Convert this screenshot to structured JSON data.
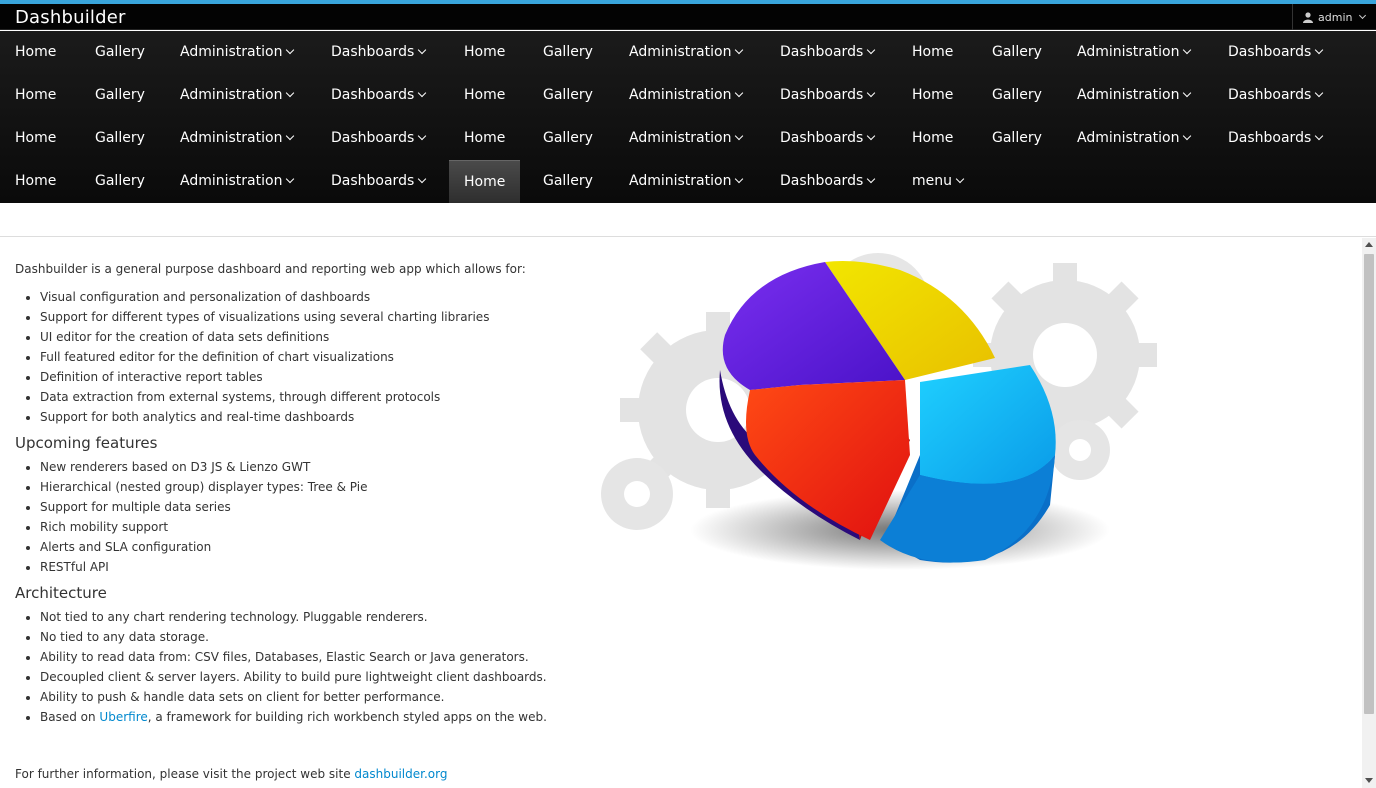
{
  "app": {
    "brand": "Dashbuilder",
    "user": "admin"
  },
  "nav": {
    "rows": [
      [
        "Home",
        "Gallery",
        "Administration",
        "Dashboards",
        "Home",
        "Gallery",
        "Administration",
        "Dashboards",
        "Home",
        "Gallery",
        "Administration",
        "Dashboards"
      ],
      [
        "Home",
        "Gallery",
        "Administration",
        "Dashboards",
        "Home",
        "Gallery",
        "Administration",
        "Dashboards",
        "Home",
        "Gallery",
        "Administration",
        "Dashboards"
      ],
      [
        "Home",
        "Gallery",
        "Administration",
        "Dashboards",
        "Home",
        "Gallery",
        "Administration",
        "Dashboards",
        "Home",
        "Gallery",
        "Administration",
        "Dashboards"
      ],
      [
        "Home",
        "Gallery",
        "Administration",
        "Dashboards",
        "Home",
        "Gallery",
        "Administration",
        "Dashboards",
        "menu"
      ]
    ],
    "active": "Home (row 4)"
  },
  "content": {
    "intro": "Dashbuilder is a general purpose dashboard and reporting web app which allows for:",
    "features": [
      "Visual configuration and personalization of dashboards",
      "Support for different types of visualizations using several charting libraries",
      "UI editor for the creation of data sets definitions",
      "Full featured editor for the definition of chart visualizations",
      "Definition of interactive report tables",
      "Data extraction from external systems, through different protocols",
      "Support for both analytics and real-time dashboards"
    ],
    "upcoming_title": "Upcoming features",
    "upcoming": [
      "New renderers based on D3 JS & Lienzo GWT",
      "Hierarchical (nested group) displayer types: Tree & Pie",
      "Support for multiple data series",
      "Rich mobility support",
      "Alerts and SLA configuration",
      "RESTful API"
    ],
    "architecture_title": "Architecture",
    "architecture": [
      "Not tied to any chart rendering technology. Pluggable renderers.",
      "No tied to any data storage.",
      "Ability to read data from: CSV files, Databases, Elastic Search or Java generators.",
      "Decoupled client & server layers. Ability to build pure lightweight client dashboards.",
      "Ability to push & handle data sets on client for better performance."
    ],
    "based_on_prefix": "Based on ",
    "based_on_link": "Uberfire",
    "based_on_suffix": ", a framework for building rich workbench styled apps on the web.",
    "more_info_prefix": "For further information, please visit the project web site ",
    "more_info_link": "dashbuilder.org"
  },
  "icons": {
    "user": "user-icon",
    "caret": "chevron-down-icon",
    "illustration": "pie-chart-gears-illustration"
  },
  "colors": {
    "accent": "#39a5dc",
    "link": "#0088ce",
    "navbar": "#111111"
  }
}
